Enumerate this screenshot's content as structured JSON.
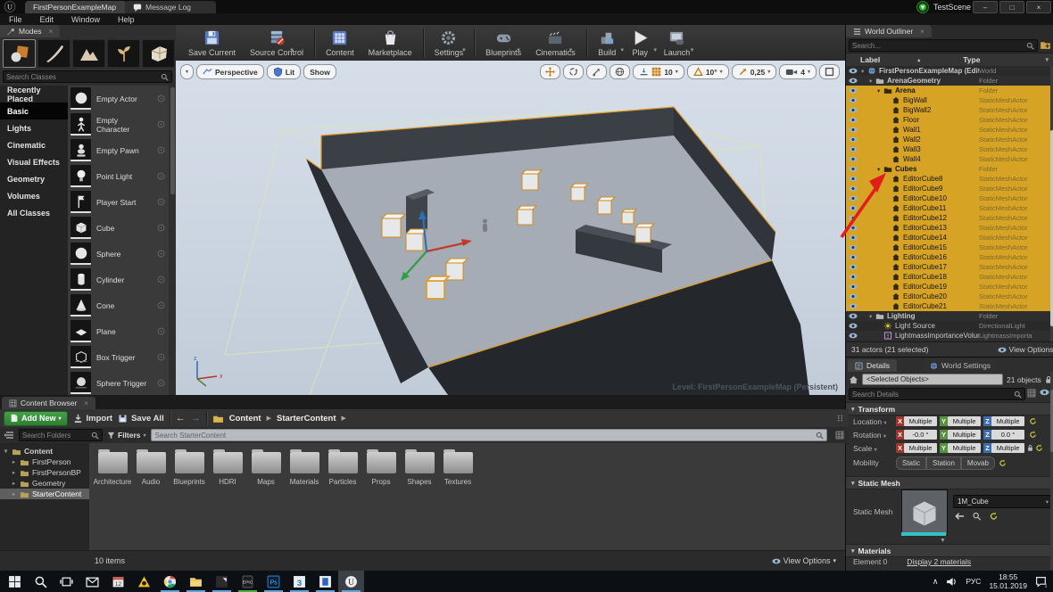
{
  "window": {
    "tabs": [
      {
        "label": "FirstPersonExampleMap",
        "active": true
      },
      {
        "label": "Message Log",
        "active": false
      }
    ],
    "recorder": {
      "label": "TestScene"
    },
    "controls": [
      "–",
      "□",
      "×"
    ],
    "menu": [
      "File",
      "Edit",
      "Window",
      "Help"
    ]
  },
  "modes": {
    "tab_label": "Modes",
    "tools": [
      "place-tool-icon",
      "paint-tool-icon",
      "landscape-tool-icon",
      "foliage-tool-icon",
      "geometry-tool-icon"
    ],
    "active_tool": "place-tool-icon",
    "search_placeholder": "Search Classes",
    "categories": [
      "Recently Placed",
      "Basic",
      "Lights",
      "Cinematic",
      "Visual Effects",
      "Geometry",
      "Volumes",
      "All Classes"
    ],
    "active_category": "Basic",
    "items": [
      {
        "label": "Empty Actor",
        "icon": "sphere-icon"
      },
      {
        "label": "Empty Character",
        "icon": "character-icon"
      },
      {
        "label": "Empty Pawn",
        "icon": "pawn-icon"
      },
      {
        "label": "Point Light",
        "icon": "bulb-icon"
      },
      {
        "label": "Player Start",
        "icon": "flag-icon"
      },
      {
        "label": "Cube",
        "icon": "cube-icon"
      },
      {
        "label": "Sphere",
        "icon": "sphere-icon"
      },
      {
        "label": "Cylinder",
        "icon": "cylinder-icon"
      },
      {
        "label": "Cone",
        "icon": "cone-icon"
      },
      {
        "label": "Plane",
        "icon": "plane-icon"
      },
      {
        "label": "Box Trigger",
        "icon": "box-trigger-icon"
      },
      {
        "label": "Sphere Trigger",
        "icon": "sphere-trigger-icon"
      }
    ]
  },
  "toolbar": {
    "buttons": [
      {
        "label": "Save Current",
        "icon": "save-icon",
        "caret": false
      },
      {
        "label": "Source Control",
        "icon": "source-control-icon",
        "caret": true
      },
      {
        "label": "Content",
        "icon": "content-icon",
        "caret": false
      },
      {
        "label": "Marketplace",
        "icon": "marketplace-icon",
        "caret": false
      },
      {
        "label": "Settings",
        "icon": "settings-icon",
        "caret": true
      },
      {
        "label": "Blueprints",
        "icon": "blueprints-icon",
        "caret": true
      },
      {
        "label": "Cinematics",
        "icon": "cinematics-icon",
        "caret": true
      },
      {
        "label": "Build",
        "icon": "build-icon",
        "caret": true
      },
      {
        "label": "Play",
        "icon": "play-icon",
        "caret": true
      },
      {
        "label": "Launch",
        "icon": "launch-icon",
        "caret": true
      }
    ]
  },
  "viewport": {
    "camera_mode": "Perspective",
    "lighting_mode": "Lit",
    "show_label": "Show",
    "grid_snap": "10",
    "rotation_snap": "10°",
    "scale_snap": "0,25",
    "camera_speed": "4",
    "level_label": "Level:  FirstPersonExampleMap (Persistent)"
  },
  "outliner": {
    "tab_label": "World Outliner",
    "search_placeholder": "Search...",
    "columns": [
      "Label",
      "Type"
    ],
    "rows": [
      {
        "label": "FirstPersonExampleMap (Editor)",
        "type": "World",
        "depth": 0,
        "selected": false,
        "icon": "world-icon",
        "expanded": true
      },
      {
        "label": "ArenaGeometry",
        "type": "Folder",
        "depth": 1,
        "selected": false,
        "icon": "folder-icon",
        "expanded": true
      },
      {
        "label": "Arena",
        "type": "Folder",
        "depth": 2,
        "selected": true,
        "icon": "folder-icon",
        "expanded": true
      },
      {
        "label": "BigWall",
        "type": "StaticMeshActor",
        "depth": 3,
        "selected": true,
        "icon": "mesh-icon"
      },
      {
        "label": "BigWall2",
        "type": "StaticMeshActor",
        "depth": 3,
        "selected": true,
        "icon": "mesh-icon"
      },
      {
        "label": "Floor",
        "type": "StaticMeshActor",
        "depth": 3,
        "selected": true,
        "icon": "mesh-icon"
      },
      {
        "label": "Wall1",
        "type": "StaticMeshActor",
        "depth": 3,
        "selected": true,
        "icon": "mesh-icon"
      },
      {
        "label": "Wall2",
        "type": "StaticMeshActor",
        "depth": 3,
        "selected": true,
        "icon": "mesh-icon"
      },
      {
        "label": "Wall3",
        "type": "StaticMeshActor",
        "depth": 3,
        "selected": true,
        "icon": "mesh-icon"
      },
      {
        "label": "Wall4",
        "type": "StaticMeshActor",
        "depth": 3,
        "selected": true,
        "icon": "mesh-icon"
      },
      {
        "label": "Cubes",
        "type": "Folder",
        "depth": 2,
        "selected": true,
        "icon": "folder-icon",
        "expanded": true
      },
      {
        "label": "EditorCube8",
        "type": "StaticMeshActor",
        "depth": 3,
        "selected": true,
        "icon": "mesh-icon"
      },
      {
        "label": "EditorCube9",
        "type": "StaticMeshActor",
        "depth": 3,
        "selected": true,
        "icon": "mesh-icon"
      },
      {
        "label": "EditorCube10",
        "type": "StaticMeshActor",
        "depth": 3,
        "selected": true,
        "icon": "mesh-icon"
      },
      {
        "label": "EditorCube11",
        "type": "StaticMeshActor",
        "depth": 3,
        "selected": true,
        "icon": "mesh-icon"
      },
      {
        "label": "EditorCube12",
        "type": "StaticMeshActor",
        "depth": 3,
        "selected": true,
        "icon": "mesh-icon"
      },
      {
        "label": "EditorCube13",
        "type": "StaticMeshActor",
        "depth": 3,
        "selected": true,
        "icon": "mesh-icon"
      },
      {
        "label": "EditorCube14",
        "type": "StaticMeshActor",
        "depth": 3,
        "selected": true,
        "icon": "mesh-icon"
      },
      {
        "label": "EditorCube15",
        "type": "StaticMeshActor",
        "depth": 3,
        "selected": true,
        "icon": "mesh-icon"
      },
      {
        "label": "EditorCube16",
        "type": "StaticMeshActor",
        "depth": 3,
        "selected": true,
        "icon": "mesh-icon"
      },
      {
        "label": "EditorCube17",
        "type": "StaticMeshActor",
        "depth": 3,
        "selected": true,
        "icon": "mesh-icon"
      },
      {
        "label": "EditorCube18",
        "type": "StaticMeshActor",
        "depth": 3,
        "selected": true,
        "icon": "mesh-icon"
      },
      {
        "label": "EditorCube19",
        "type": "StaticMeshActor",
        "depth": 3,
        "selected": true,
        "icon": "mesh-icon"
      },
      {
        "label": "EditorCube20",
        "type": "StaticMeshActor",
        "depth": 3,
        "selected": true,
        "icon": "mesh-icon"
      },
      {
        "label": "EditorCube21",
        "type": "StaticMeshActor",
        "depth": 3,
        "selected": true,
        "icon": "mesh-icon"
      },
      {
        "label": "Lighting",
        "type": "Folder",
        "depth": 1,
        "selected": false,
        "icon": "folder-icon",
        "expanded": true
      },
      {
        "label": "Light Source",
        "type": "DirectionalLight",
        "depth": 2,
        "selected": false,
        "icon": "sun-icon"
      },
      {
        "label": "LightmassImportanceVolume",
        "type": "LightmassImporta",
        "depth": 2,
        "selected": false,
        "icon": "volume-icon"
      }
    ],
    "footer": "31 actors (21 selected)",
    "view_options": "View Options"
  },
  "details": {
    "tabs": [
      {
        "label": "Details",
        "icon": "details-icon",
        "active": true
      },
      {
        "label": "World Settings",
        "icon": "globe-icon",
        "active": false
      }
    ],
    "selected_objects": "<Selected Objects>",
    "objects_count": "21 objects",
    "search_placeholder": "Search Details",
    "transform_section": "Transform",
    "transform_rows": [
      {
        "label": "Location",
        "x": "Multiple",
        "y": "Multiple",
        "z": "Multiple"
      },
      {
        "label": "Rotation",
        "x": "-0.0 °",
        "y": "Multiple",
        "z": "0.0 °"
      },
      {
        "label": "Scale",
        "x": "Multiple",
        "y": "Multiple",
        "z": "Multiple"
      }
    ],
    "mobility_label": "Mobility",
    "mobility_options": [
      "Static",
      "Station",
      "Movab"
    ],
    "static_mesh_section": "Static Mesh",
    "static_mesh_label": "Static Mesh",
    "static_mesh_value": "1M_Cube",
    "materials_section": "Materials",
    "material_element": "Element 0",
    "material_link": "Display 2 materials"
  },
  "content_browser": {
    "tab_label": "Content Browser",
    "add_new": "Add New",
    "import": "Import",
    "save_all": "Save All",
    "breadcrumb": [
      "Content",
      "StarterContent"
    ],
    "search_folders_placeholder": "Search Folders",
    "filters_label": "Filters",
    "search_placeholder": "Search StarterContent",
    "tree": [
      {
        "label": "Content",
        "depth": 0,
        "selected": false,
        "expanded": true
      },
      {
        "label": "FirstPerson",
        "depth": 1,
        "selected": false,
        "expanded": false
      },
      {
        "label": "FirstPersonBP",
        "depth": 1,
        "selected": false,
        "expanded": false
      },
      {
        "label": "Geometry",
        "depth": 1,
        "selected": false,
        "expanded": false
      },
      {
        "label": "StarterContent",
        "depth": 1,
        "selected": true,
        "expanded": false
      }
    ],
    "folders": [
      "Architecture",
      "Audio",
      "Blueprints",
      "HDRI",
      "Maps",
      "Materials",
      "Particles",
      "Props",
      "Shapes",
      "Textures"
    ],
    "items_count": "10 items",
    "view_options": "View Options"
  },
  "taskbar": {
    "pinned": [
      "windows-start-icon",
      "taskbar-search-icon",
      "task-view-icon",
      "mail-icon",
      "calendar-icon",
      "yellow-triangle-app-icon",
      "chrome-icon",
      "explorer-icon",
      "dark-app-icon",
      "epic-icon",
      "photoshop-icon",
      "3dsmax-icon",
      "blue-app-icon",
      "unreal-icon"
    ],
    "running": [
      "chrome-icon",
      "explorer-icon",
      "dark-app-icon",
      "epic-icon",
      "photoshop-icon",
      "3dsmax-icon",
      "blue-app-icon",
      "unreal-icon"
    ],
    "active": "unreal-icon",
    "tray": {
      "lang": "РУС",
      "time": "18:55",
      "date": "15.01.2019"
    }
  },
  "colors": {
    "selection_orange": "#D7A325",
    "annotation_red": "#E02018",
    "axis_x": "#9E352B",
    "axis_y": "#56933A",
    "axis_z": "#3A6DB0"
  }
}
